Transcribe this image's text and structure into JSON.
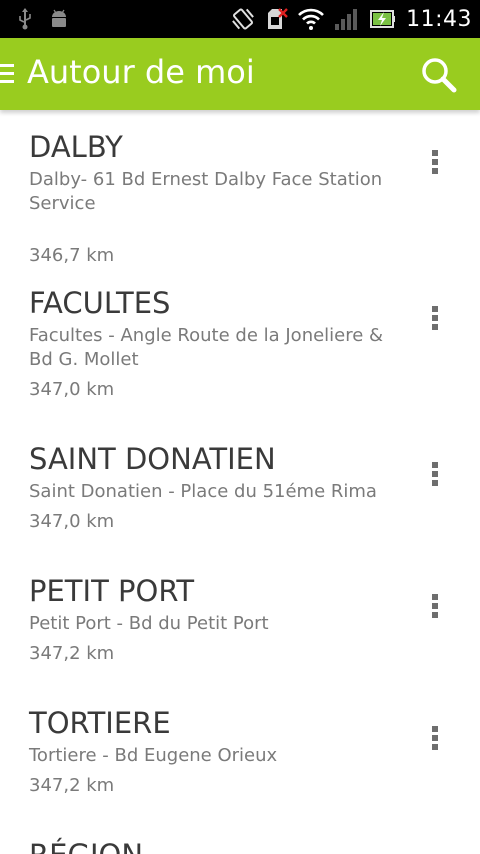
{
  "status_bar": {
    "time": "11:43",
    "icons": [
      "usb-icon",
      "android-debug-icon",
      "vibrate-icon",
      "no-sim-icon",
      "wifi-icon",
      "signal-icon",
      "battery-charging-icon"
    ]
  },
  "header": {
    "title": "Autour de moi",
    "menu_icon": "hamburger-menu-icon",
    "search_icon": "search-icon"
  },
  "colors": {
    "action_bar": "#99cc1f",
    "status_bar": "#000000",
    "title_text": "#3a3a3a",
    "secondary_text": "#7a7a7a"
  },
  "stations": [
    {
      "name": "DALBY",
      "address": "Dalby- 61 Bd Ernest Dalby Face Station Service",
      "distance": "346,7 km"
    },
    {
      "name": "FACULTES",
      "address": "Facultes - Angle Route de la Joneliere & Bd G. Mollet",
      "distance": "347,0 km"
    },
    {
      "name": "SAINT DONATIEN",
      "address": "Saint Donatien - Place du 51éme Rima",
      "distance": "347,0 km"
    },
    {
      "name": "PETIT PORT",
      "address": "Petit Port - Bd du Petit Port",
      "distance": "347,2 km"
    },
    {
      "name": "TORTIERE",
      "address": "Tortiere - Bd Eugene Orieux",
      "distance": "347,2 km"
    },
    {
      "name": "RÉGION",
      "address": "",
      "distance": ""
    }
  ]
}
